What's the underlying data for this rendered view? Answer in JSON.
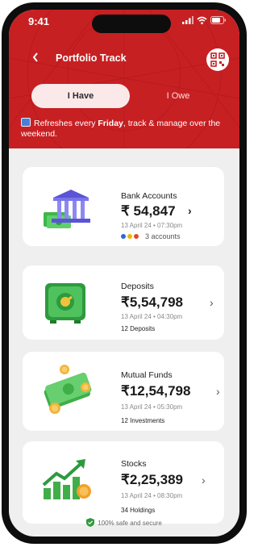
{
  "status_bar": {
    "time": "9:41"
  },
  "header": {
    "back_icon": "chevron-left-icon",
    "title": "Portfolio Track",
    "qr_icon": "qr-code-icon"
  },
  "tabs": [
    {
      "label": "I Have",
      "active": true
    },
    {
      "label": "I Owe",
      "active": false
    }
  ],
  "notice": {
    "prefix": "Refreshes every ",
    "bold": "Friday",
    "suffix": ", track & manage  over the weekend."
  },
  "cards": [
    {
      "name": "Bank Accounts",
      "amount": "₹ 54,847",
      "date": "13 April 24 • 07:30pm",
      "meta": "3 accounts",
      "icon": "bank-icon"
    },
    {
      "name": "Deposits",
      "amount": "₹5,54,798",
      "date": "13 April 24 • 04:30pm",
      "meta": "12 Deposits",
      "icon": "safe-icon"
    },
    {
      "name": "Mutual Funds",
      "amount": "₹12,54,798",
      "date": "13 April 24 • 05:30pm",
      "meta": "12 Investments",
      "icon": "money-icon"
    },
    {
      "name": "Stocks",
      "amount": "₹2,25,389",
      "date": "13 April 24 • 08:30pm",
      "meta": "34 Holdings",
      "icon": "growth-chart-icon"
    }
  ],
  "footer": {
    "text": "100% safe and secure",
    "icon": "shield-check-icon"
  },
  "colors": {
    "brand_red": "#c72023",
    "tab_bg": "#fbe9ea"
  }
}
